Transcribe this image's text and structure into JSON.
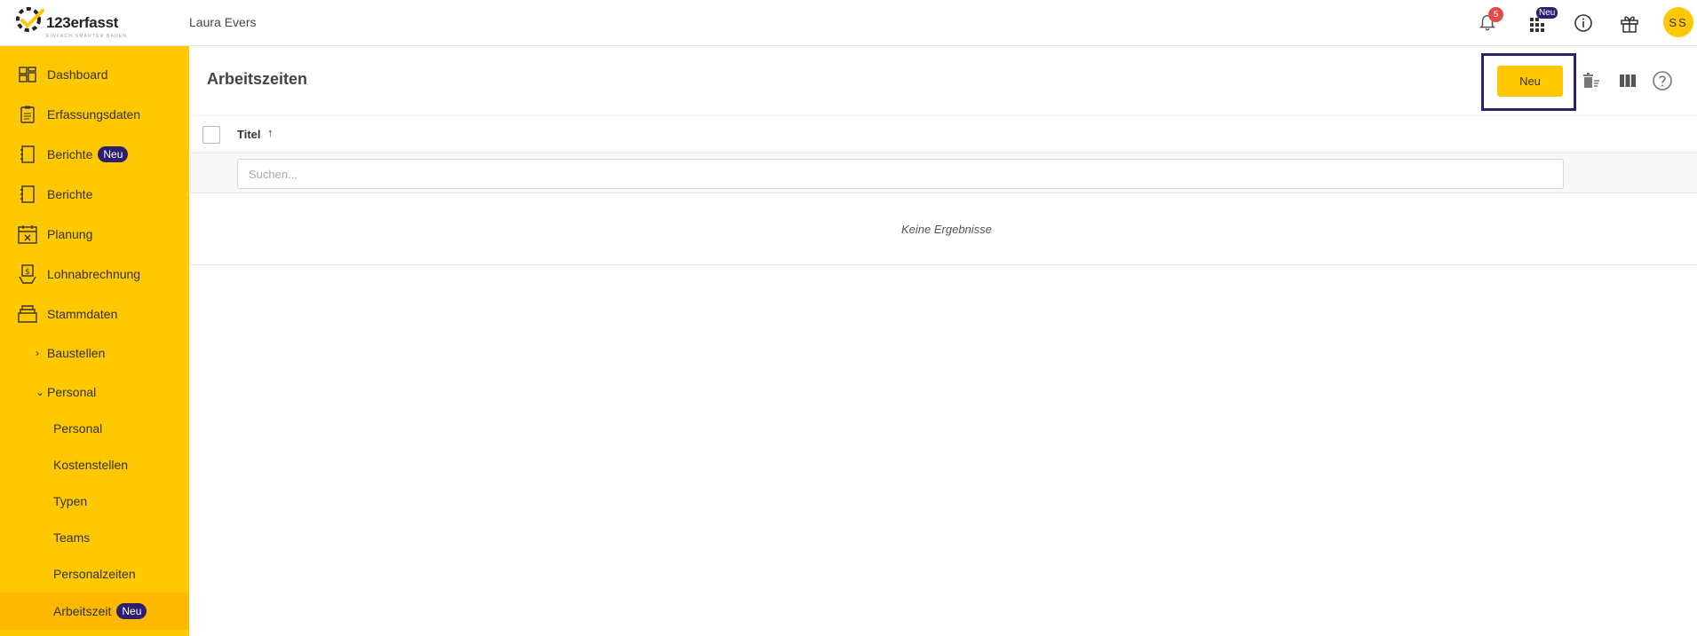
{
  "brand": {
    "name": "123erfasst",
    "tagline": "EINFACH SMARTER BAUEN"
  },
  "header": {
    "user_name": "Laura Evers",
    "notification_count": "5",
    "apps_badge": "Neu",
    "avatar_initials": "SS"
  },
  "sidebar": {
    "items": [
      {
        "label": "Dashboard",
        "icon": "dashboard-icon"
      },
      {
        "label": "Erfassungsdaten",
        "icon": "clipboard-icon"
      },
      {
        "label": "Berichte",
        "icon": "report-icon",
        "badge": "Neu"
      },
      {
        "label": "Berichte",
        "icon": "report-icon"
      },
      {
        "label": "Planung",
        "icon": "calendar-icon"
      },
      {
        "label": "Lohnabrechnung",
        "icon": "payroll-icon"
      },
      {
        "label": "Stammdaten",
        "icon": "database-icon"
      }
    ],
    "sub_items": [
      {
        "label": "Baustellen",
        "expanded": false
      },
      {
        "label": "Personal",
        "expanded": true
      }
    ],
    "personal_items": [
      {
        "label": "Personal"
      },
      {
        "label": "Kostenstellen"
      },
      {
        "label": "Typen"
      },
      {
        "label": "Teams"
      },
      {
        "label": "Personalzeiten"
      },
      {
        "label": "Arbeitszeit",
        "badge": "Neu",
        "active": true
      }
    ]
  },
  "main": {
    "title": "Arbeitszeiten",
    "new_button": "Neu",
    "table": {
      "column_title": "Titel",
      "sort_direction": "ascending",
      "search_placeholder": "Suchen...",
      "empty_message": "Keine Ergebnisse"
    }
  },
  "colors": {
    "accent": "#ffc800",
    "active": "#ffb800",
    "badge": "#2d1f6e",
    "notification": "#e54848"
  }
}
